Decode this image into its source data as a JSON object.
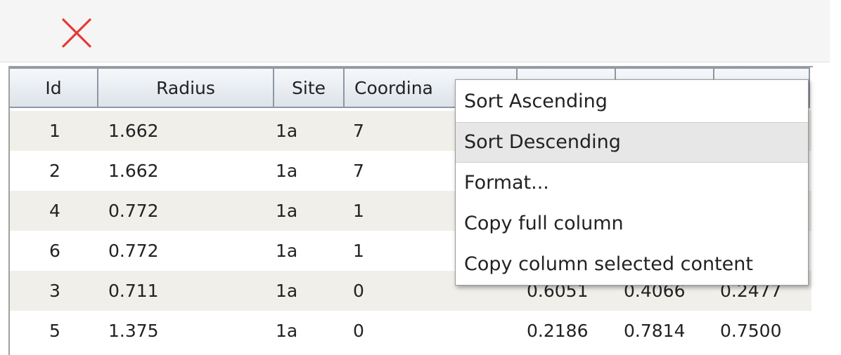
{
  "toolbar": {
    "close_icon": "close-x-icon",
    "close_color": "#e53935"
  },
  "table": {
    "columns": [
      "Id",
      "Radius",
      "Site",
      "Coordina",
      "",
      "",
      ""
    ],
    "rows": [
      {
        "id": "1",
        "radius": "1.662",
        "site": "1a",
        "coord": "7",
        "x": "",
        "y": "",
        "z": ""
      },
      {
        "id": "2",
        "radius": "1.662",
        "site": "1a",
        "coord": "7",
        "x": "",
        "y": "",
        "z": ""
      },
      {
        "id": "4",
        "radius": "0.772",
        "site": "1a",
        "coord": "1",
        "x": "",
        "y": "",
        "z": ""
      },
      {
        "id": "6",
        "radius": "0.772",
        "site": "1a",
        "coord": "1",
        "x": "",
        "y": "",
        "z": ""
      },
      {
        "id": "3",
        "radius": "0.711",
        "site": "1a",
        "coord": "0",
        "x": "0.6051",
        "y": "0.4066",
        "z": "0.2477"
      },
      {
        "id": "5",
        "radius": "1.375",
        "site": "1a",
        "coord": "0",
        "x": "0.2186",
        "y": "0.7814",
        "z": "0.7500"
      }
    ]
  },
  "context_menu": {
    "items": [
      {
        "label": "Sort Ascending"
      },
      {
        "label": "Sort Descending",
        "highlighted": true
      },
      {
        "label": "Format..."
      },
      {
        "label": "Copy full column"
      },
      {
        "label": "Copy column selected content"
      }
    ]
  }
}
